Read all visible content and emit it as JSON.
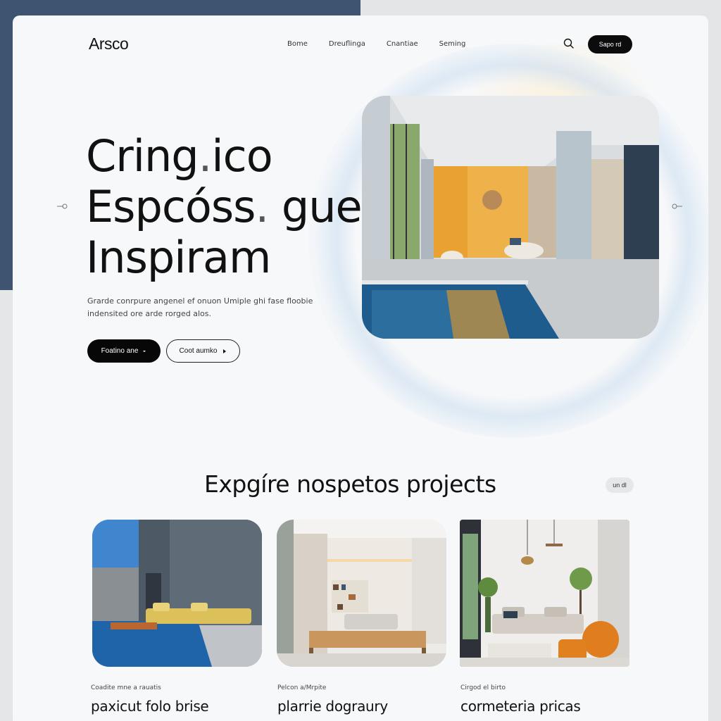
{
  "brand": {
    "logo": "Arsco"
  },
  "nav": {
    "items": [
      "Bome",
      "Dreuflinga",
      "Cnantiae",
      "Seming"
    ]
  },
  "header": {
    "cta_label": "Sapo rd"
  },
  "hero": {
    "line1": "Cring",
    "line1_dot": ".",
    "line1_rest": "ico",
    "line2": "Espcóss",
    "line2_dot": ".",
    "line2_rest": " gue",
    "line3": "Inspiram",
    "description_line1": "Grarde conrpure angenel ef onuon Umiple ghi fase floobie",
    "description_line2": "indensited ore arde rorged alos.",
    "primary_button": "Foatino ane",
    "secondary_button": "Coot aumko"
  },
  "section": {
    "title": "Expgíre nospetos projects",
    "pill": "un dl"
  },
  "projects": [
    {
      "meta": "Coadite mne a rauatis",
      "title": "paxicut folo brise"
    },
    {
      "meta": "Pelcon a/Mrpite",
      "title": "plarrie dograury"
    },
    {
      "meta": "Cirgod el birto",
      "title": "cormeteria pricas"
    }
  ],
  "colors": {
    "navy": "#3e5470",
    "accent_orange": "#e9a132",
    "pool_blue": "#1f5c8e",
    "black": "#0c0c0c"
  },
  "icons": {
    "search": "search-icon",
    "chevron": "chevron-down-icon",
    "arrow": "arrow-right-icon"
  }
}
